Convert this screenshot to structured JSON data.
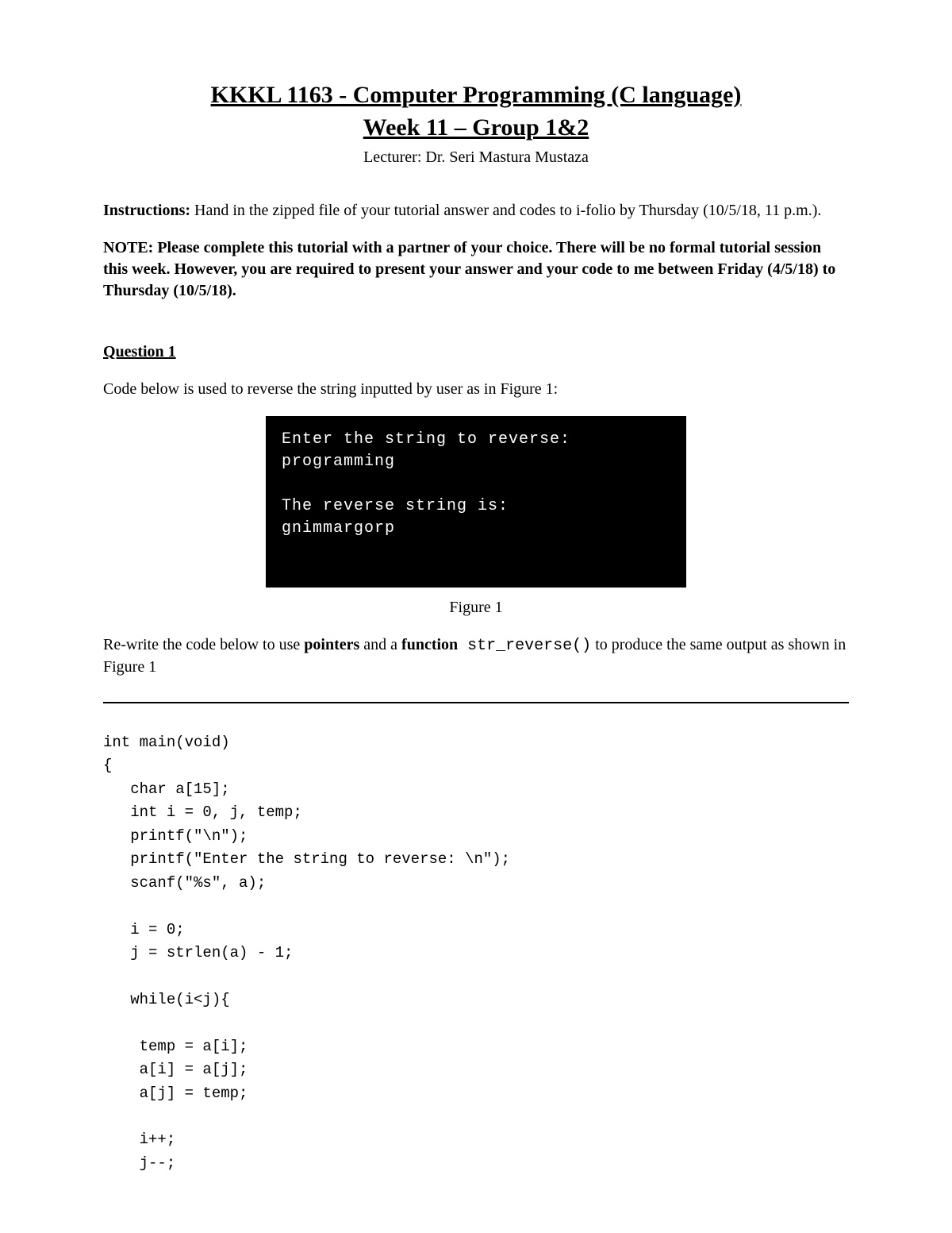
{
  "header": {
    "title": "KKKL 1163 - Computer Programming (C language)",
    "subtitle": "Week 11 – Group 1&2",
    "lecturer": "Lecturer: Dr. Seri Mastura Mustaza"
  },
  "instructions": {
    "label": "Instructions:",
    "text": " Hand in the zipped file of your tutorial answer and codes to i-folio by Thursday (10/5/18, 11 p.m.)."
  },
  "note": "NOTE: Please complete this tutorial with a partner of your choice. There will be no formal tutorial session this week. However, you are required to present your answer and your code to me between Friday (4/5/18) to Thursday (10/5/18).",
  "question": {
    "heading": "Question 1",
    "intro": "Code below is used to reverse the string inputted by user as in Figure 1:",
    "terminal": "Enter the string to reverse:\nprogramming\n\nThe reverse string is:\ngnimmargorp",
    "figure_caption": "Figure 1",
    "rewrite_pre": "Re-write the code below to use ",
    "rewrite_bold1": "pointers",
    "rewrite_mid": " and a ",
    "rewrite_bold2": "function",
    "rewrite_code": " str_reverse()",
    "rewrite_post": " to produce the same output as shown in Figure 1"
  },
  "code": "int main(void)\n{\n   char a[15];\n   int i = 0, j, temp;\n   printf(\"\\n\");\n   printf(\"Enter the string to reverse: \\n\");\n   scanf(\"%s\", a);\n\n   i = 0;\n   j = strlen(a) - 1;\n\n   while(i<j){\n\n    temp = a[i];\n    a[i] = a[j];\n    a[j] = temp;\n\n    i++;\n    j--;"
}
